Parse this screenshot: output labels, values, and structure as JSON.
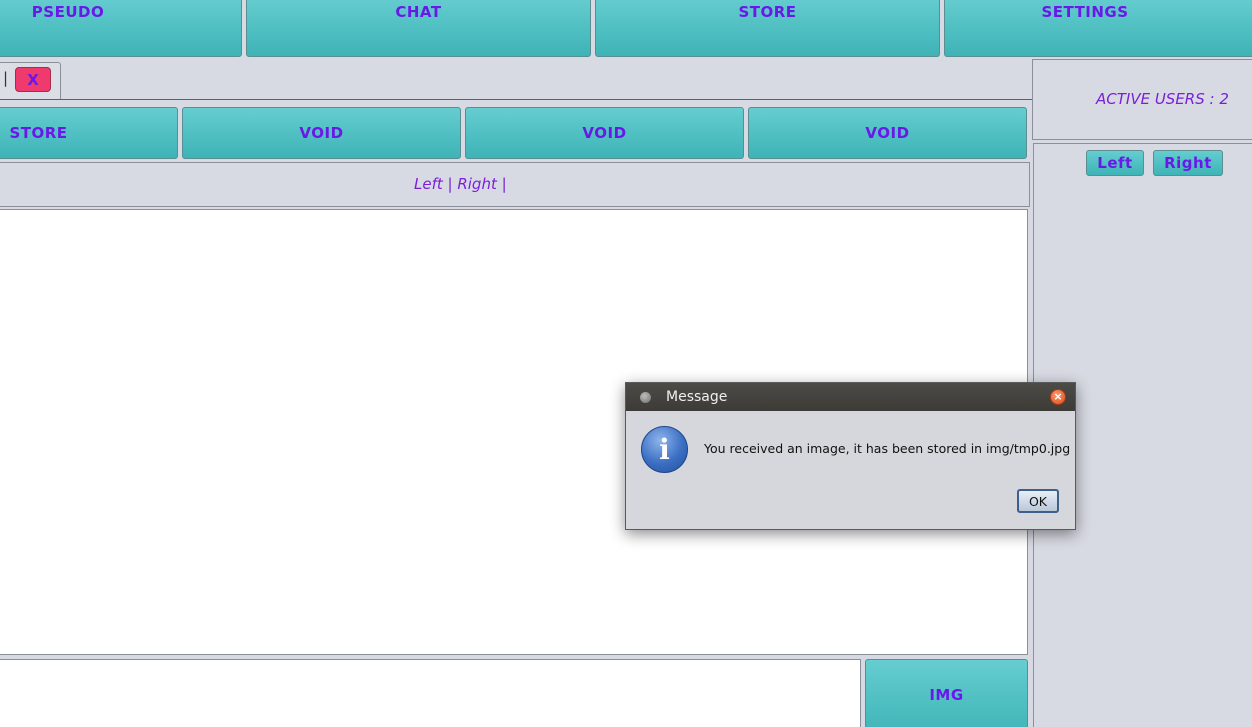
{
  "top_nav": {
    "pseudo": "PSEUDO",
    "chat": "CHAT",
    "store": "STORE",
    "settings": "SETTINGS"
  },
  "tab_bar": {
    "separator": "|",
    "close_label": "X"
  },
  "action_row": {
    "store": "STORE",
    "void1": "VOID",
    "void2": "VOID",
    "void3": "VOID"
  },
  "status_line": "Left | Right |",
  "right_panel": {
    "active_users": "ACTIVE USERS : 2",
    "left_button": "Left",
    "right_button": "Right"
  },
  "bottom": {
    "img_button": "IMG"
  },
  "dialog": {
    "title": "Message",
    "message": "You received an image, it has been stored in img/tmp0.jpg",
    "ok": "OK",
    "icon_glyph": "i"
  },
  "colors": {
    "button_teal": "#4fbfc2",
    "label_purple": "#6a18e8",
    "close_red": "#ee3a6c",
    "background": "#d8dae3"
  }
}
